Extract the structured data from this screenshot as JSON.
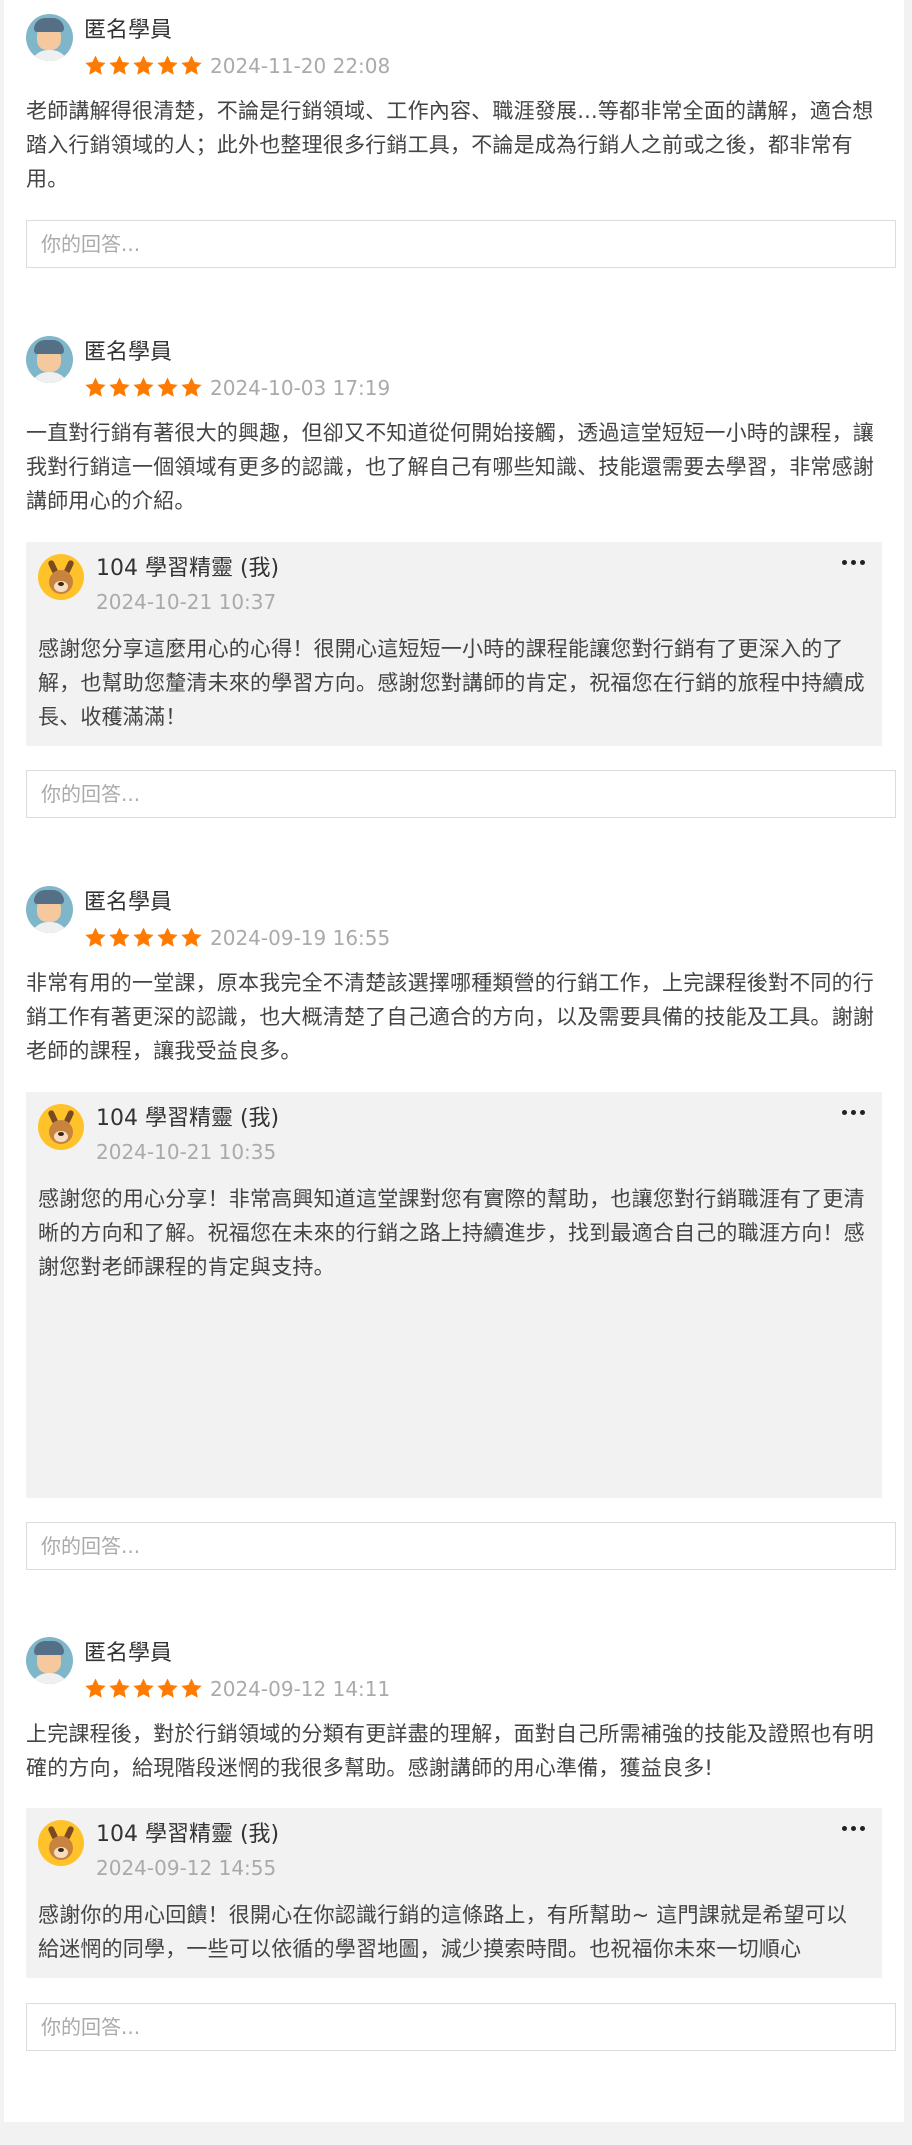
{
  "colors": {
    "star": "#ff7a00",
    "reply_bg": "#f2f2f2",
    "muted": "#aaaaaa"
  },
  "icons": {
    "star": "star-icon",
    "more": "more-options-icon"
  },
  "reviews": [
    {
      "name": "匿名學員",
      "rating": 5,
      "date": "2024-11-20 22:08",
      "content": "老師講解得很清楚，不論是行銷領域、工作內容、職涯發展...等都非常全面的講解，適合想踏入行銷領域的人；此外也整理很多行銷工具，不論是成為行銷人之前或之後，都非常有用。",
      "reply": null,
      "answer_placeholder": "你的回答..."
    },
    {
      "name": "匿名學員",
      "rating": 5,
      "date": "2024-10-03 17:19",
      "content": "一直對行銷有著很大的興趣，但卻又不知道從何開始接觸，透過這堂短短一小時的課程，讓我對行銷這一個領域有更多的認識，也了解自己有哪些知識、技能還需要去學習，非常感謝講師用心的介紹。",
      "reply": {
        "name": "104 學習精靈 (我)",
        "date": "2024-10-21 10:37",
        "text": "感謝您分享這麼用心的心得！很開心這短短一小時的課程能讓您對行銷有了更深入的了解，也幫助您釐清未來的學習方向。感謝您對講師的肯定，祝福您在行銷的旅程中持續成長、收穫滿滿！"
      },
      "answer_placeholder": "你的回答..."
    },
    {
      "name": "匿名學員",
      "rating": 5,
      "date": "2024-09-19 16:55",
      "content": "非常有用的一堂課，原本我完全不清楚該選擇哪種類營的行銷工作，上完課程後對不同的行銷工作有著更深的認識，也大概清楚了自己適合的方向，以及需要具備的技能及工具。謝謝老師的課程，讓我受益良多。",
      "reply": {
        "name": "104 學習精靈 (我)",
        "date": "2024-10-21 10:35",
        "text": "感謝您的用心分享！非常高興知道這堂課對您有實際的幫助，也讓您對行銷職涯有了更清晰的方向和了解。祝福您在未來的行銷之路上持續進步，找到最適合自己的職涯方向！感謝您對老師課程的肯定與支持。"
      },
      "answer_placeholder": "你的回答..."
    },
    {
      "name": "匿名學員",
      "rating": 5,
      "date": "2024-09-12 14:11",
      "content": "上完課程後，對於行銷領域的分類有更詳盡的理解，面對自己所需補強的技能及證照也有明確的方向，給現階段迷惘的我很多幫助。感謝講師的用心準備，獲益良多!",
      "reply": {
        "name": "104 學習精靈 (我)",
        "date": "2024-09-12 14:55",
        "text": "感謝你的用心回饋！很開心在你認識行銷的這條路上，有所幫助~ 這門課就是希望可以給迷惘的同學，一些可以依循的學習地圖，減少摸索時間。也祝福你未來一切順心"
      },
      "answer_placeholder": "你的回答..."
    }
  ]
}
